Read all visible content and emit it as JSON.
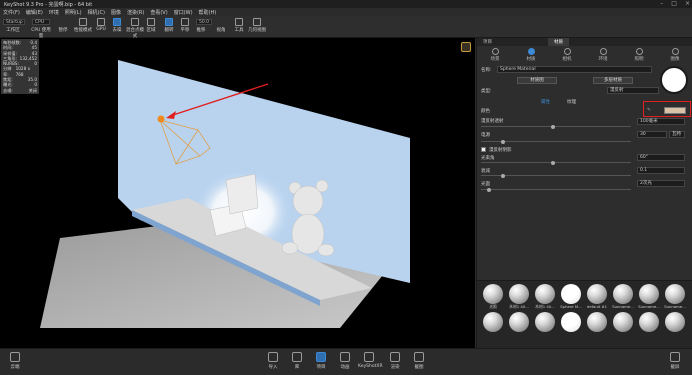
{
  "window": {
    "title": "KeyShot 9.3 Pro - 完蛋啊.bip - 64 bit"
  },
  "menu": [
    "文件(F)",
    "编辑(E)",
    "环境",
    "照明(L)",
    "相机(C)",
    "图像",
    "渲染(R)",
    "查看(V)",
    "窗口(W)",
    "帮助(H)"
  ],
  "toolbar": {
    "workspace_select": "Startup",
    "cpu_select": "CPU",
    "fps_value": "50.0",
    "items": [
      "工作区",
      "CPU 使用量",
      "暂停",
      "性能模式",
      "GPU",
      "去噪",
      "混合点模式",
      "区域",
      "翻转",
      "平移",
      "推移",
      "视角",
      "工具",
      "几何视图"
    ]
  },
  "hud": {
    "rows": [
      {
        "k": "每秒帧数:",
        "v": "0.4"
      },
      {
        "k": "时间:",
        "v": "45"
      },
      {
        "k": "采样值:",
        "v": "43"
      },
      {
        "k": "三角形:",
        "v": "132,452"
      },
      {
        "k": "NURBS:",
        "v": "0"
      },
      {
        "k": "分辨率:",
        "v": "1028 x 768"
      },
      {
        "k": "焦距:",
        "v": "35.0"
      },
      {
        "k": "曝光:",
        "v": "0"
      },
      {
        "k": "去噪:",
        "v": "关闭"
      }
    ]
  },
  "panel": {
    "tabs": [
      "项目",
      "材质"
    ],
    "active_tab": "材质",
    "subtabs": [
      "场景",
      "材质",
      "相机",
      "环境",
      "照明",
      "图像"
    ],
    "active_subtab": "材质",
    "name_label": "名称:",
    "name_value": "Sphere Material",
    "btn_material_graph": "材质图",
    "btn_link": "多层材质",
    "type_label": "类型:",
    "type_value": "漫反射",
    "inner_tabs": [
      "属性",
      "纹理"
    ],
    "active_inner": "属性",
    "color_label": "颜色",
    "color_value": "#d8c2a8",
    "diffuse_label": "漫反射透射",
    "unit_value": "100毫米",
    "power_label": "电源",
    "power_value": "30",
    "power_unit": "瓦特",
    "roughness_check": "漫反射阴影",
    "angle_label": "光束角",
    "angle_value": "60°",
    "falloff_label": "衰减",
    "falloff_value": "0.1",
    "mode_label": "光面",
    "mode_value": "2次光",
    "library": [
      "光照",
      "木材1 40...",
      "木材1 40...",
      "Sphere M...",
      "default #1",
      "Sunname...",
      "Sunname...",
      "Sunname...",
      "",
      "",
      "",
      "",
      "",
      "",
      "",
      ""
    ]
  },
  "bottombar": {
    "left": "云端",
    "items": [
      "导入",
      "库",
      "项目",
      "动画",
      "KeyShotXR",
      "渲染",
      "截图"
    ],
    "active": "项目",
    "right": "截屏"
  },
  "colors": {
    "accent": "#3d8bd6",
    "highlight": "#e02020",
    "wall": "#b9d3ef"
  }
}
